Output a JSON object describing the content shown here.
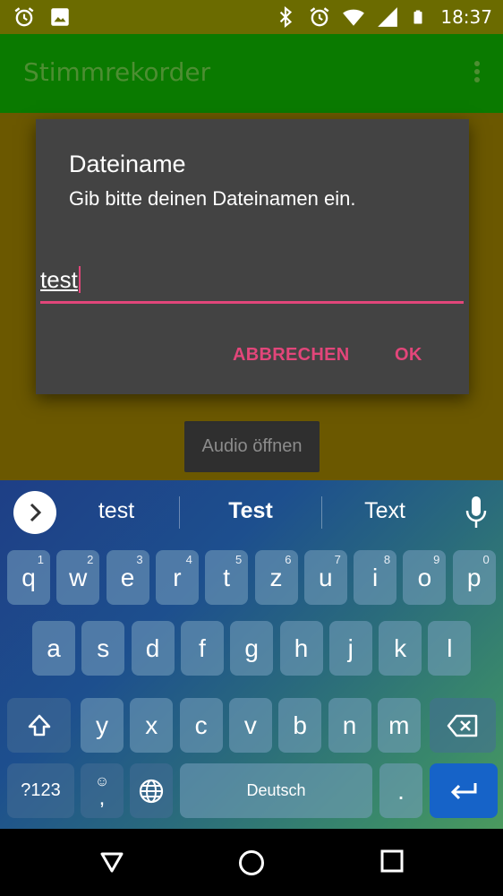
{
  "status_bar": {
    "time": "18:37",
    "left_icons": [
      "alarm-icon",
      "image-icon"
    ],
    "right_icons": [
      "bluetooth-icon",
      "alarm-icon",
      "wifi-icon",
      "signal-icon",
      "battery-icon"
    ]
  },
  "app_bar": {
    "title": "Stimmrekorder",
    "menu_icon": "overflow-menu-icon"
  },
  "main": {
    "audio_button_label": "Audio öffnen"
  },
  "dialog": {
    "title": "Dateiname",
    "message": "Gib bitte deinen Dateinamen ein.",
    "input_value": "test",
    "cancel_label": "ABBRECHEN",
    "ok_label": "OK",
    "accent_color": "#e2467a"
  },
  "keyboard": {
    "suggestions": [
      "test",
      "Test",
      "Text"
    ],
    "row1": [
      {
        "key": "q",
        "hint": "1"
      },
      {
        "key": "w",
        "hint": "2"
      },
      {
        "key": "e",
        "hint": "3"
      },
      {
        "key": "r",
        "hint": "4"
      },
      {
        "key": "t",
        "hint": "5"
      },
      {
        "key": "z",
        "hint": "6"
      },
      {
        "key": "u",
        "hint": "7"
      },
      {
        "key": "i",
        "hint": "8"
      },
      {
        "key": "o",
        "hint": "9"
      },
      {
        "key": "p",
        "hint": "0"
      }
    ],
    "row2": [
      "a",
      "s",
      "d",
      "f",
      "g",
      "h",
      "j",
      "k",
      "l"
    ],
    "row3": [
      "y",
      "x",
      "c",
      "v",
      "b",
      "n",
      "m"
    ],
    "symbols_label": "?123",
    "comma_label": ",",
    "space_label": "Deutsch",
    "period_label": ".",
    "enter_color": "#1663c8"
  },
  "nav_bar": {
    "icons": [
      "back-icon",
      "home-icon",
      "recents-icon"
    ]
  }
}
